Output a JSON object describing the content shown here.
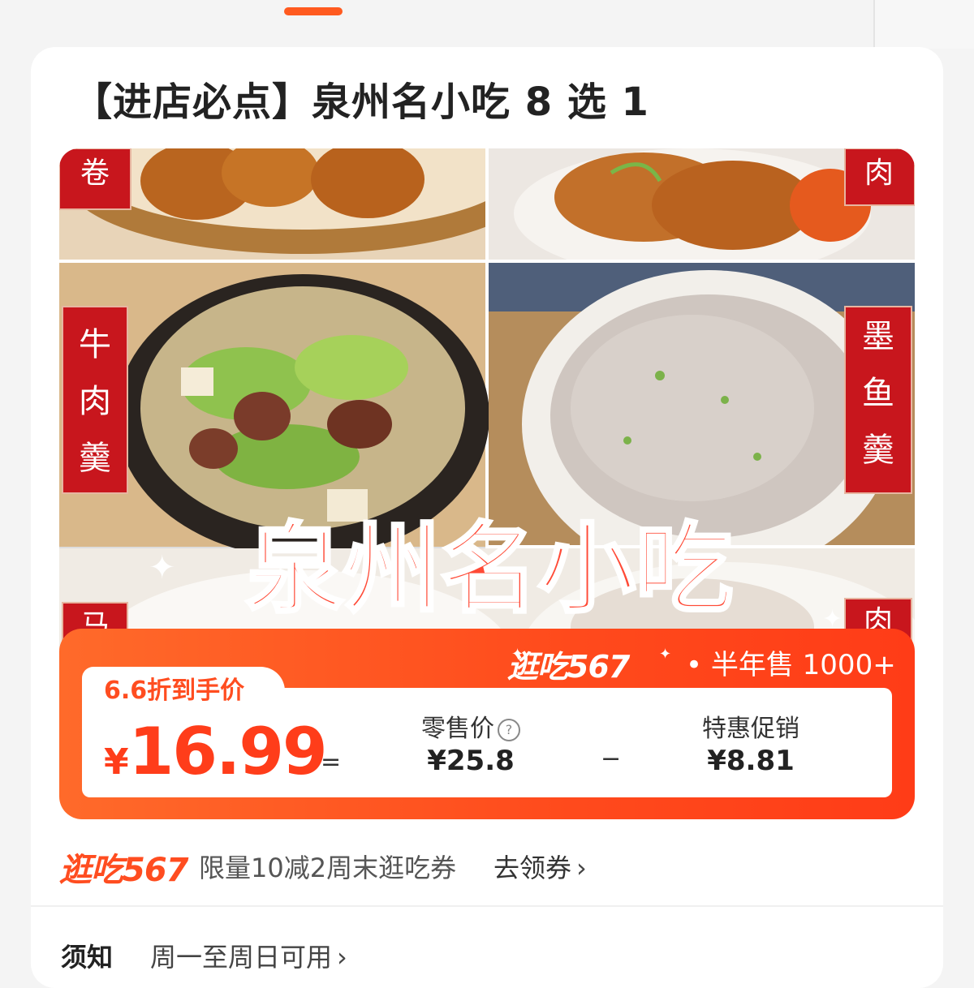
{
  "header": {
    "title": "【进店必点】泉州名小吃 8 选 1"
  },
  "food_image": {
    "overlay_title": "泉州名小吃",
    "labels": {
      "top_left": "卷",
      "top_right": "肉",
      "mid_left": "牛肉羹",
      "mid_right": "墨鱼羹",
      "bottom_left": "马",
      "bottom_right": "肉"
    }
  },
  "price_panel": {
    "brand": "逛吃567",
    "sales": "• 半年售 1000+",
    "deal_label": "6.6折到手价",
    "final_price": {
      "currency": "¥",
      "amount": "16.99"
    },
    "equals": "=",
    "minus": "−",
    "retail": {
      "label": "零售价",
      "help_icon": "?",
      "value": "¥25.8"
    },
    "promo": {
      "label": "特惠促销",
      "value": "¥8.81"
    }
  },
  "coupon": {
    "brand": "逛吃567",
    "text": "限量10减2周末逛吃券",
    "action": "去领券",
    "chevron": "›"
  },
  "notice": {
    "label": "须知",
    "value": "周一至周日可用",
    "chevron": "›"
  },
  "colors": {
    "accent": "#ff4d20",
    "panel": "#ff5a22",
    "label_red": "#c8161d"
  }
}
